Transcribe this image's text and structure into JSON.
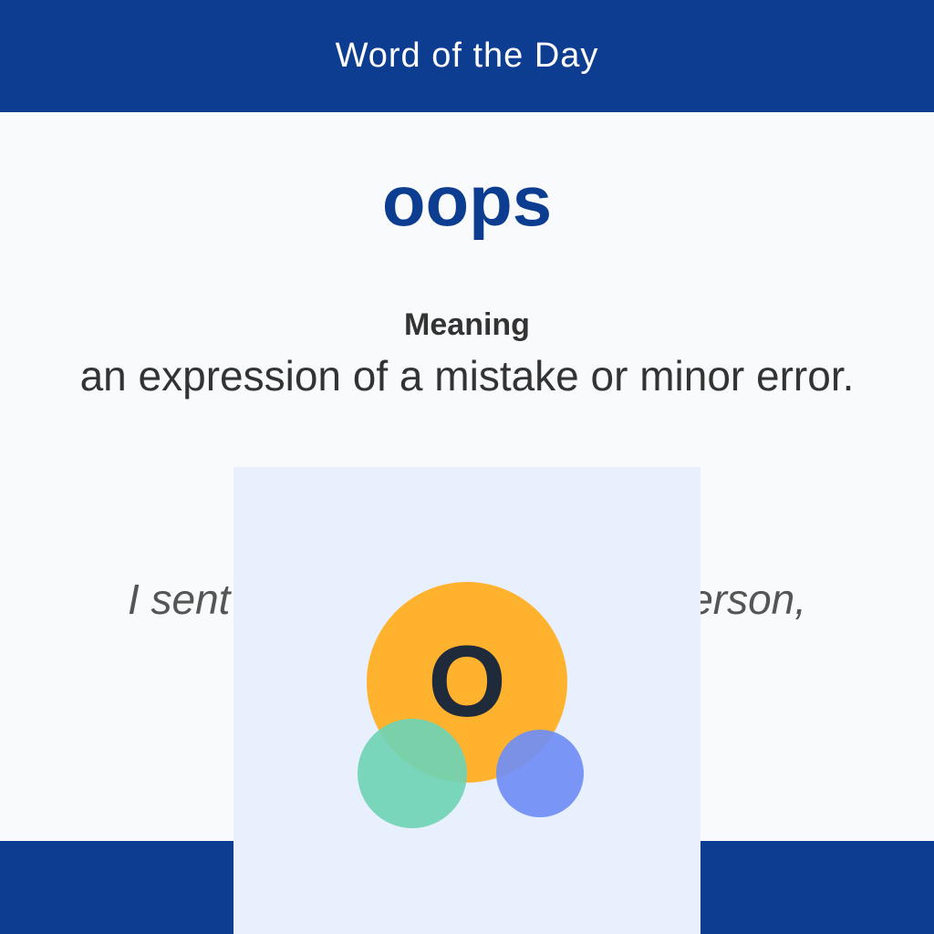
{
  "header": {
    "title": "Word of the Day"
  },
  "word": {
    "text": "oops"
  },
  "meaning": {
    "label": "Meaning",
    "text": "an expression of a mistake or minor error."
  },
  "example": {
    "text": "I sent the email to the wrong person, oops, to my boss."
  },
  "overlay": {
    "avatar_letter": "O",
    "colors": {
      "main_circle": "#ffb22e",
      "green_circle": "#6fd4b4",
      "blue_circle": "#6f8ef5",
      "card_background": "#e8effd"
    }
  },
  "theme": {
    "primary": "#0d3d91",
    "background": "#f8fafc",
    "text": "#333333"
  }
}
